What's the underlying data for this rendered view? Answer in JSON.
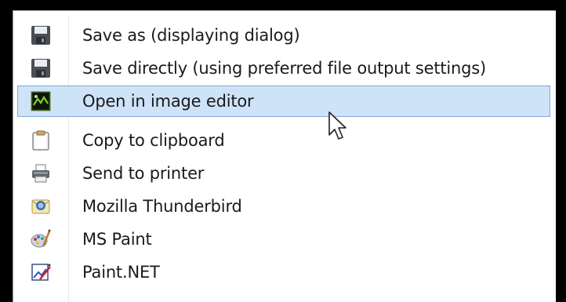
{
  "menu": {
    "items": [
      {
        "label": "Save as (displaying dialog)",
        "icon": "floppy-disk-icon"
      },
      {
        "label": "Save directly (using preferred file output settings)",
        "icon": "floppy-disk-icon"
      },
      {
        "label": "Open in image editor",
        "icon": "image-editor-icon"
      },
      {
        "label": "Copy to clipboard",
        "icon": "clipboard-icon"
      },
      {
        "label": "Send to printer",
        "icon": "printer-icon"
      },
      {
        "label": "Mozilla Thunderbird",
        "icon": "thunderbird-icon"
      },
      {
        "label": "MS Paint",
        "icon": "ms-paint-palette-icon"
      },
      {
        "label": "Paint.NET",
        "icon": "paint-net-icon"
      }
    ],
    "hovered_item": "Open in image editor"
  },
  "colors": {
    "hover_background": "#cfe3f8",
    "hover_border": "#7fa9d8",
    "text": "#1a1a1a",
    "backdrop": "#000000"
  }
}
